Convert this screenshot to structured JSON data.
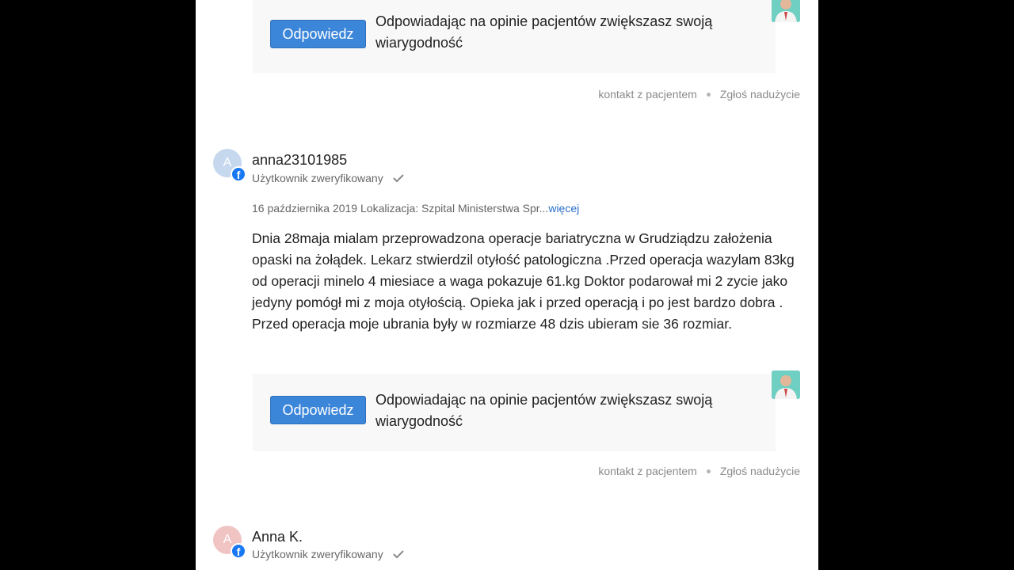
{
  "reply_prompt": {
    "button_label": "Odpowiedz",
    "text": "Odpowiadając na opinie pacjentów zwiększasz swoją wiarygodność"
  },
  "footer": {
    "contact_label": "kontakt z pacjentem",
    "report_label": "Zgłoś nadużycie"
  },
  "reviews": [
    {
      "avatar_letter": "A",
      "username": "anna23101985",
      "verified_label": "Użytkownik zweryfikowany",
      "date": "16 października 2019",
      "location": "Lokalizacja: Szpital Ministerstwa Spr...",
      "more_label": "więcej",
      "text": "Dnia 28maja mialam przeprowadzona operacje bariatryczna w Grudziądzu założenia opaski na żołądek. Lekarz stwierdzil otyłość patologiczna .Przed operacja wazylam 83kg od operacji minelo 4 miesiace a waga pokazuje 61.kg Doktor podarował mi 2 zycie jako jedyny pomógł mi z moja otyłością. Opieka jak i przed operacją i po jest bardzo dobra . Przed operacja moje ubrania były w rozmiarze 48 dzis ubieram sie 36 rozmiar.",
      "avatar_color": "#c5d8ee"
    },
    {
      "avatar_letter": "A",
      "username": "Anna K.",
      "verified_label": "Użytkownik zweryfikowany",
      "avatar_color": "#f1c4c4"
    }
  ],
  "colors": {
    "accent": "#3c86da",
    "link": "#2a6fc9",
    "facebook": "#1877f2"
  }
}
